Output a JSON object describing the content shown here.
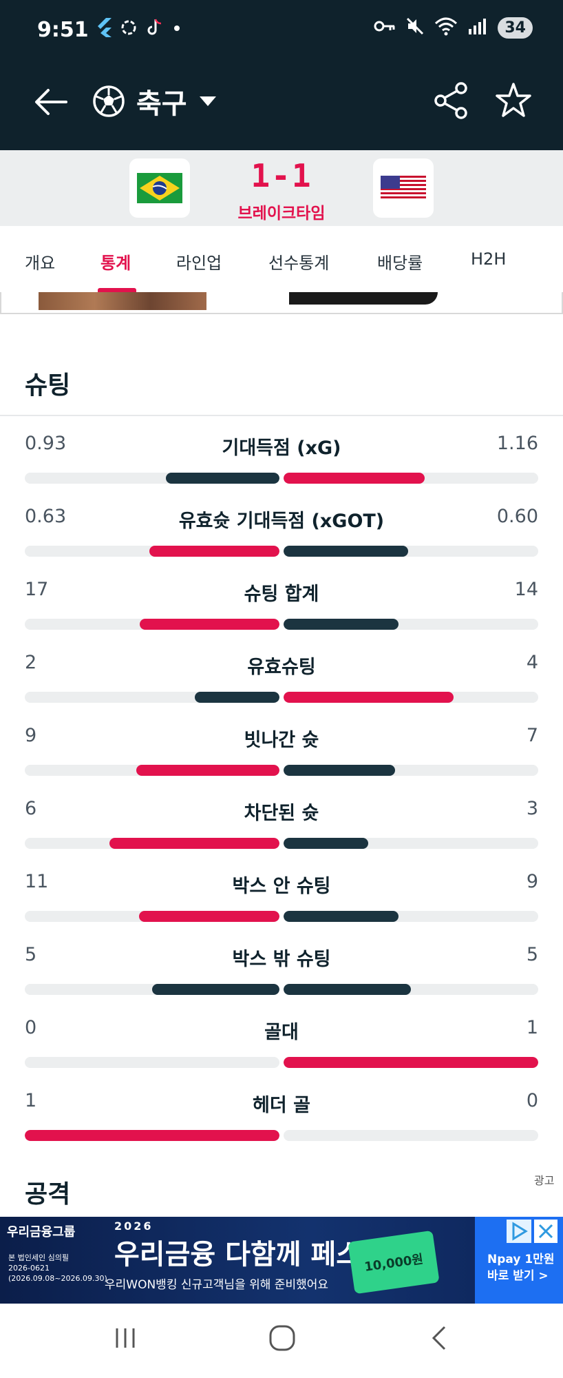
{
  "status_bar": {
    "time": "9:51",
    "battery": "34",
    "icons": [
      "flutter-icon",
      "sync-icon",
      "tiktok-icon",
      "dot-icon",
      "key-icon",
      "mute-icon",
      "wifi-icon",
      "signal-icon"
    ]
  },
  "app_bar": {
    "sport_label": "축구",
    "icons": [
      "back-arrow-icon",
      "soccer-ball-icon",
      "caret-down-icon",
      "share-icon",
      "star-icon"
    ]
  },
  "match": {
    "home_team_flag": "brazil-flag",
    "away_team_flag": "usa-flag",
    "score": "1-1",
    "status": "브레이크타임"
  },
  "tabs": [
    {
      "label": "개요",
      "active": false
    },
    {
      "label": "통계",
      "active": true
    },
    {
      "label": "라인업",
      "active": false
    },
    {
      "label": "선수통계",
      "active": false
    },
    {
      "label": "배당률",
      "active": false
    },
    {
      "label": "H2H",
      "active": false
    }
  ],
  "colors": {
    "accent": "#e2124d",
    "dark": "#1b3440",
    "track": "#eceeef",
    "header_bg": "#0f222c"
  },
  "sections": [
    {
      "title": "슈팅"
    },
    {
      "title": "공격"
    }
  ],
  "shooting_stats": [
    {
      "label": "기대득점 (xG)",
      "home": "0.93",
      "away": "1.16",
      "home_frac": 0.445,
      "away_frac": 0.555,
      "leader": "away"
    },
    {
      "label": "유효슛 기대득점 (xGOT)",
      "home": "0.63",
      "away": "0.60",
      "home_frac": 0.512,
      "away_frac": 0.488,
      "leader": "home"
    },
    {
      "label": "슈팅 합계",
      "home": "17",
      "away": "14",
      "home_frac": 0.548,
      "away_frac": 0.452,
      "leader": "home"
    },
    {
      "label": "유효슈팅",
      "home": "2",
      "away": "4",
      "home_frac": 0.333,
      "away_frac": 0.667,
      "leader": "away"
    },
    {
      "label": "빗나간 슛",
      "home": "9",
      "away": "7",
      "home_frac": 0.563,
      "away_frac": 0.438,
      "leader": "home"
    },
    {
      "label": "차단된 슛",
      "home": "6",
      "away": "3",
      "home_frac": 0.667,
      "away_frac": 0.333,
      "leader": "home"
    },
    {
      "label": "박스 안 슈팅",
      "home": "11",
      "away": "9",
      "home_frac": 0.55,
      "away_frac": 0.45,
      "leader": "home"
    },
    {
      "label": "박스 밖 슈팅",
      "home": "5",
      "away": "5",
      "home_frac": 0.5,
      "away_frac": 0.5,
      "leader": "none"
    },
    {
      "label": "골대",
      "home": "0",
      "away": "1",
      "home_frac": 0.0,
      "away_frac": 1.0,
      "leader": "away"
    },
    {
      "label": "헤더 골",
      "home": "1",
      "away": "0",
      "home_frac": 1.0,
      "away_frac": 0.0,
      "leader": "home"
    }
  ],
  "ad": {
    "label": "광고",
    "brand": "우리금융그룹",
    "year": "2026",
    "headline": "우리금융 다함께 페스타",
    "subtext": "우리WON뱅킹 신규고객님을 위해 준비했어요",
    "small_text": [
      "본 법인세인 심의필",
      "2026-0621",
      "(2026.09.08~2026.09.30)"
    ],
    "money": "10,000원",
    "side_text": "Npay 1만원 바로 받기 >",
    "icons": [
      "ad-info-icon",
      "ad-close-icon"
    ]
  },
  "nav_bar": {
    "icons": [
      "recents-icon",
      "home-icon",
      "back-icon"
    ]
  }
}
